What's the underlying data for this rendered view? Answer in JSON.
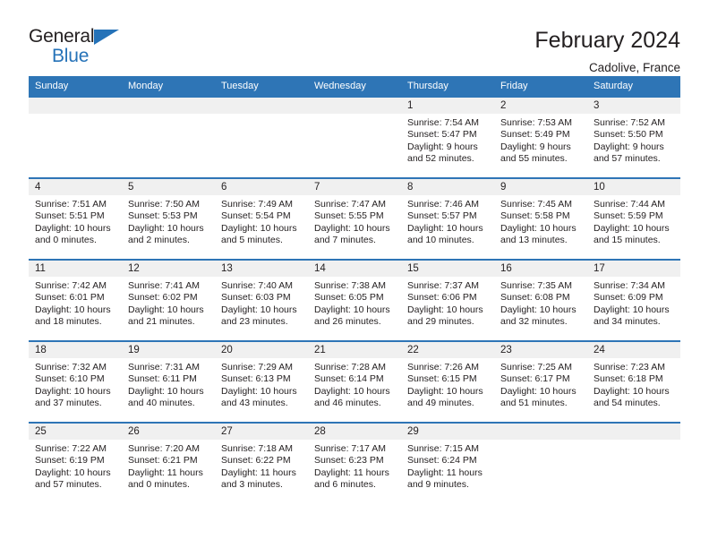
{
  "brand": {
    "name_top": "General",
    "name_bottom": "Blue",
    "accent_color": "#2572b8",
    "triangle_icon": "triangle-logo-icon"
  },
  "header": {
    "title": "February 2024",
    "location": "Cadolive, France"
  },
  "calendar": {
    "header_bg": "#2e75b6",
    "daynum_band_bg": "#f0f0f0",
    "weekday_headers": [
      "Sunday",
      "Monday",
      "Tuesday",
      "Wednesday",
      "Thursday",
      "Friday",
      "Saturday"
    ],
    "weeks": [
      [
        {
          "day": "",
          "sunrise": "",
          "sunset": "",
          "daylight_1": "",
          "daylight_2": ""
        },
        {
          "day": "",
          "sunrise": "",
          "sunset": "",
          "daylight_1": "",
          "daylight_2": ""
        },
        {
          "day": "",
          "sunrise": "",
          "sunset": "",
          "daylight_1": "",
          "daylight_2": ""
        },
        {
          "day": "",
          "sunrise": "",
          "sunset": "",
          "daylight_1": "",
          "daylight_2": ""
        },
        {
          "day": "1",
          "sunrise": "Sunrise: 7:54 AM",
          "sunset": "Sunset: 5:47 PM",
          "daylight_1": "Daylight: 9 hours",
          "daylight_2": "and 52 minutes."
        },
        {
          "day": "2",
          "sunrise": "Sunrise: 7:53 AM",
          "sunset": "Sunset: 5:49 PM",
          "daylight_1": "Daylight: 9 hours",
          "daylight_2": "and 55 minutes."
        },
        {
          "day": "3",
          "sunrise": "Sunrise: 7:52 AM",
          "sunset": "Sunset: 5:50 PM",
          "daylight_1": "Daylight: 9 hours",
          "daylight_2": "and 57 minutes."
        }
      ],
      [
        {
          "day": "4",
          "sunrise": "Sunrise: 7:51 AM",
          "sunset": "Sunset: 5:51 PM",
          "daylight_1": "Daylight: 10 hours",
          "daylight_2": "and 0 minutes."
        },
        {
          "day": "5",
          "sunrise": "Sunrise: 7:50 AM",
          "sunset": "Sunset: 5:53 PM",
          "daylight_1": "Daylight: 10 hours",
          "daylight_2": "and 2 minutes."
        },
        {
          "day": "6",
          "sunrise": "Sunrise: 7:49 AM",
          "sunset": "Sunset: 5:54 PM",
          "daylight_1": "Daylight: 10 hours",
          "daylight_2": "and 5 minutes."
        },
        {
          "day": "7",
          "sunrise": "Sunrise: 7:47 AM",
          "sunset": "Sunset: 5:55 PM",
          "daylight_1": "Daylight: 10 hours",
          "daylight_2": "and 7 minutes."
        },
        {
          "day": "8",
          "sunrise": "Sunrise: 7:46 AM",
          "sunset": "Sunset: 5:57 PM",
          "daylight_1": "Daylight: 10 hours",
          "daylight_2": "and 10 minutes."
        },
        {
          "day": "9",
          "sunrise": "Sunrise: 7:45 AM",
          "sunset": "Sunset: 5:58 PM",
          "daylight_1": "Daylight: 10 hours",
          "daylight_2": "and 13 minutes."
        },
        {
          "day": "10",
          "sunrise": "Sunrise: 7:44 AM",
          "sunset": "Sunset: 5:59 PM",
          "daylight_1": "Daylight: 10 hours",
          "daylight_2": "and 15 minutes."
        }
      ],
      [
        {
          "day": "11",
          "sunrise": "Sunrise: 7:42 AM",
          "sunset": "Sunset: 6:01 PM",
          "daylight_1": "Daylight: 10 hours",
          "daylight_2": "and 18 minutes."
        },
        {
          "day": "12",
          "sunrise": "Sunrise: 7:41 AM",
          "sunset": "Sunset: 6:02 PM",
          "daylight_1": "Daylight: 10 hours",
          "daylight_2": "and 21 minutes."
        },
        {
          "day": "13",
          "sunrise": "Sunrise: 7:40 AM",
          "sunset": "Sunset: 6:03 PM",
          "daylight_1": "Daylight: 10 hours",
          "daylight_2": "and 23 minutes."
        },
        {
          "day": "14",
          "sunrise": "Sunrise: 7:38 AM",
          "sunset": "Sunset: 6:05 PM",
          "daylight_1": "Daylight: 10 hours",
          "daylight_2": "and 26 minutes."
        },
        {
          "day": "15",
          "sunrise": "Sunrise: 7:37 AM",
          "sunset": "Sunset: 6:06 PM",
          "daylight_1": "Daylight: 10 hours",
          "daylight_2": "and 29 minutes."
        },
        {
          "day": "16",
          "sunrise": "Sunrise: 7:35 AM",
          "sunset": "Sunset: 6:08 PM",
          "daylight_1": "Daylight: 10 hours",
          "daylight_2": "and 32 minutes."
        },
        {
          "day": "17",
          "sunrise": "Sunrise: 7:34 AM",
          "sunset": "Sunset: 6:09 PM",
          "daylight_1": "Daylight: 10 hours",
          "daylight_2": "and 34 minutes."
        }
      ],
      [
        {
          "day": "18",
          "sunrise": "Sunrise: 7:32 AM",
          "sunset": "Sunset: 6:10 PM",
          "daylight_1": "Daylight: 10 hours",
          "daylight_2": "and 37 minutes."
        },
        {
          "day": "19",
          "sunrise": "Sunrise: 7:31 AM",
          "sunset": "Sunset: 6:11 PM",
          "daylight_1": "Daylight: 10 hours",
          "daylight_2": "and 40 minutes."
        },
        {
          "day": "20",
          "sunrise": "Sunrise: 7:29 AM",
          "sunset": "Sunset: 6:13 PM",
          "daylight_1": "Daylight: 10 hours",
          "daylight_2": "and 43 minutes."
        },
        {
          "day": "21",
          "sunrise": "Sunrise: 7:28 AM",
          "sunset": "Sunset: 6:14 PM",
          "daylight_1": "Daylight: 10 hours",
          "daylight_2": "and 46 minutes."
        },
        {
          "day": "22",
          "sunrise": "Sunrise: 7:26 AM",
          "sunset": "Sunset: 6:15 PM",
          "daylight_1": "Daylight: 10 hours",
          "daylight_2": "and 49 minutes."
        },
        {
          "day": "23",
          "sunrise": "Sunrise: 7:25 AM",
          "sunset": "Sunset: 6:17 PM",
          "daylight_1": "Daylight: 10 hours",
          "daylight_2": "and 51 minutes."
        },
        {
          "day": "24",
          "sunrise": "Sunrise: 7:23 AM",
          "sunset": "Sunset: 6:18 PM",
          "daylight_1": "Daylight: 10 hours",
          "daylight_2": "and 54 minutes."
        }
      ],
      [
        {
          "day": "25",
          "sunrise": "Sunrise: 7:22 AM",
          "sunset": "Sunset: 6:19 PM",
          "daylight_1": "Daylight: 10 hours",
          "daylight_2": "and 57 minutes."
        },
        {
          "day": "26",
          "sunrise": "Sunrise: 7:20 AM",
          "sunset": "Sunset: 6:21 PM",
          "daylight_1": "Daylight: 11 hours",
          "daylight_2": "and 0 minutes."
        },
        {
          "day": "27",
          "sunrise": "Sunrise: 7:18 AM",
          "sunset": "Sunset: 6:22 PM",
          "daylight_1": "Daylight: 11 hours",
          "daylight_2": "and 3 minutes."
        },
        {
          "day": "28",
          "sunrise": "Sunrise: 7:17 AM",
          "sunset": "Sunset: 6:23 PM",
          "daylight_1": "Daylight: 11 hours",
          "daylight_2": "and 6 minutes."
        },
        {
          "day": "29",
          "sunrise": "Sunrise: 7:15 AM",
          "sunset": "Sunset: 6:24 PM",
          "daylight_1": "Daylight: 11 hours",
          "daylight_2": "and 9 minutes."
        },
        {
          "day": "",
          "sunrise": "",
          "sunset": "",
          "daylight_1": "",
          "daylight_2": ""
        },
        {
          "day": "",
          "sunrise": "",
          "sunset": "",
          "daylight_1": "",
          "daylight_2": ""
        }
      ]
    ]
  }
}
